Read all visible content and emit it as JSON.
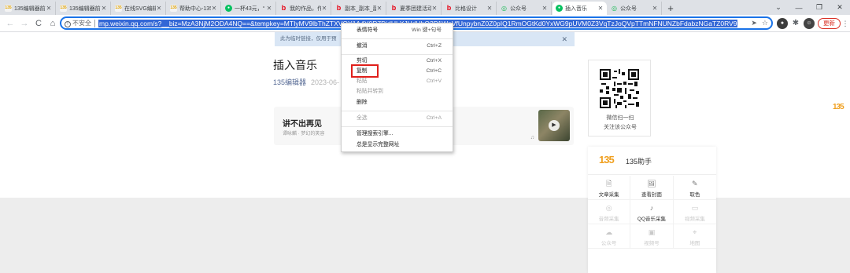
{
  "tabs": [
    {
      "icon": "135-icon",
      "title": "135编辑器前"
    },
    {
      "icon": "135-icon",
      "title": "135编辑器前"
    },
    {
      "icon": "135-icon",
      "title": "在线SVG编辑"
    },
    {
      "icon": "135-icon",
      "title": "帮助中心-135"
    },
    {
      "icon": "wechat-icon",
      "title": "一杯43元，“"
    },
    {
      "icon": "baidu-b-icon",
      "title": "我的作品，作"
    },
    {
      "icon": "baidu-b-icon",
      "title": "副本_副本_副"
    },
    {
      "icon": "baidu-b-icon",
      "title": "夏季团建活动"
    },
    {
      "icon": "baidu-b-icon",
      "title": "比格设计"
    },
    {
      "icon": "wechat-mp-icon",
      "title": "公众号"
    },
    {
      "icon": "wechat-icon",
      "title": "插入音乐",
      "active": true
    },
    {
      "icon": "wechat-mp-icon",
      "title": "公众号"
    }
  ],
  "new_tab": "+",
  "window_controls": [
    "⌄",
    "—",
    "❐",
    "✕"
  ],
  "toolbar": {
    "back": "←",
    "forward": "→",
    "reload": "C",
    "insecure_label": "不安全",
    "url": "mp.weixin.qq.com/s?__biz=MzA3NjM2ODA4NQ==&tempkey=MTIyMV9lbThZTXVQY1A4Y0R7DjdULXJHdUhQ2P1WnVfUnpybnZ0Z0pIQ1RmOGtKd0YxWG9pUVM0Z3VqTzJoQVpTTmNFNUNZbFdabzNGaTZ0RV9",
    "update_label": "更新",
    "send_icon": "➤",
    "star_icon": "☆"
  },
  "page": {
    "notice": "此为临时链接，仅用于预",
    "notice_close": "✕",
    "title": "插入音乐",
    "author": "135编辑器",
    "date": "2023-06-",
    "music": {
      "title": "讲不出再见",
      "subtitle": "谭咏麟 · 梦幻的笑容",
      "play_icon": "▶",
      "source_mark": "♫"
    },
    "qr": {
      "line1": "微信扫一扫",
      "line2": "关注该公众号"
    },
    "side_logo": "135"
  },
  "helper": {
    "logo": "135",
    "title": "135助手",
    "items": [
      {
        "icon": "🗎",
        "label": "文章采集",
        "enabled": true
      },
      {
        "icon": "🖼",
        "label": "查看封面",
        "enabled": true
      },
      {
        "icon": "✎",
        "label": "取色",
        "enabled": true
      },
      {
        "icon": "◎",
        "label": "音频采集",
        "enabled": false
      },
      {
        "icon": "♪",
        "label": "QQ音乐采集",
        "enabled": true
      },
      {
        "icon": "▭",
        "label": "视频采集",
        "enabled": false
      },
      {
        "icon": "☁",
        "label": "公众号",
        "enabled": false
      },
      {
        "icon": "▣",
        "label": "视频号",
        "enabled": false
      },
      {
        "icon": "⌖",
        "label": "地图",
        "enabled": false
      }
    ]
  },
  "context_menu": {
    "items": [
      {
        "label": "表情符号",
        "shortcut": "Win 键+句号",
        "enabled": true
      },
      {
        "label": "撤消",
        "shortcut": "Ctrl+Z",
        "enabled": true
      },
      {
        "label": "剪切",
        "shortcut": "Ctrl+X",
        "enabled": true
      },
      {
        "label": "复制",
        "shortcut": "Ctrl+C",
        "enabled": true,
        "highlighted": true
      },
      {
        "label": "粘贴",
        "shortcut": "Ctrl+V",
        "enabled": false
      },
      {
        "label": "粘贴并转到",
        "shortcut": "",
        "enabled": false
      },
      {
        "label": "删除",
        "shortcut": "",
        "enabled": true
      },
      {
        "label": "全选",
        "shortcut": "Ctrl+A",
        "enabled": false
      },
      {
        "label": "管理搜索引擎...",
        "shortcut": "",
        "enabled": true
      },
      {
        "label": "总是显示完整网址",
        "shortcut": "",
        "enabled": true
      }
    ]
  },
  "colors": {
    "accent_blue": "#1a73e8",
    "highlight_red": "#e0201b",
    "link_blue": "#576b95",
    "brand_orange": "#f0a020"
  }
}
